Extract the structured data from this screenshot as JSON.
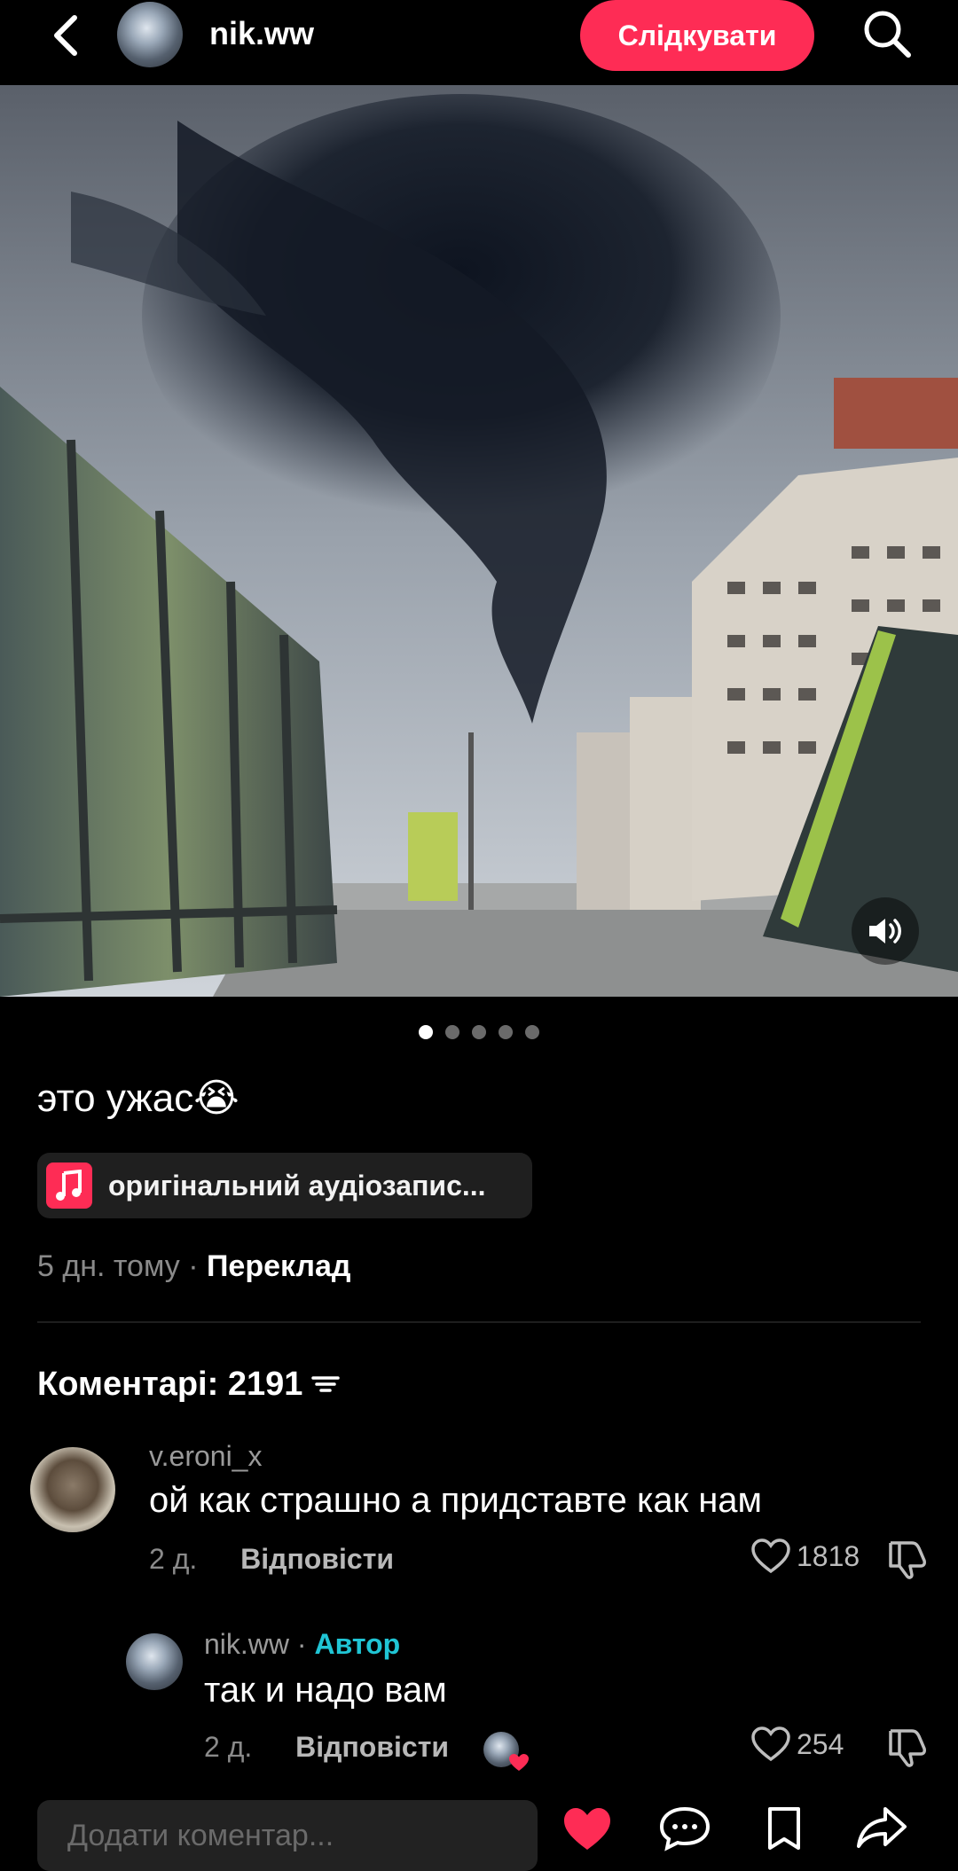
{
  "header": {
    "username": "nik.ww",
    "follow_label": "Слідкувати"
  },
  "post": {
    "caption": "это ужас😭",
    "music": "оригінальний аудіозапис...",
    "time": "5 дн. тому",
    "separator": "·",
    "translate": "Переклад",
    "carousel": {
      "count": 5,
      "active_index": 0
    }
  },
  "comments": {
    "title": "Коментарі: 2191",
    "items": [
      {
        "user": "v.eroni_x",
        "text": "ой как страшно а придставте как нам",
        "time": "2 д.",
        "reply_label": "Відповісти",
        "likes": "1818"
      },
      {
        "user": "nik.ww",
        "author_sep": " · ",
        "author_label": "Автор",
        "text": "так и надо вам",
        "time": "2 д.",
        "reply_label": "Відповісти",
        "likes": "254"
      }
    ]
  },
  "bottom_bar": {
    "input_placeholder": "Додати коментар..."
  },
  "colors": {
    "accent": "#fe2c55",
    "author": "#20c5d5",
    "background": "#000000"
  },
  "icons": [
    "back-arrow-icon",
    "search-icon",
    "sound-on-icon",
    "music-note-icon",
    "sort-icon",
    "heart-outline-icon",
    "dislike-icon",
    "heart-filled-icon",
    "comment-icon",
    "bookmark-icon",
    "share-icon"
  ]
}
